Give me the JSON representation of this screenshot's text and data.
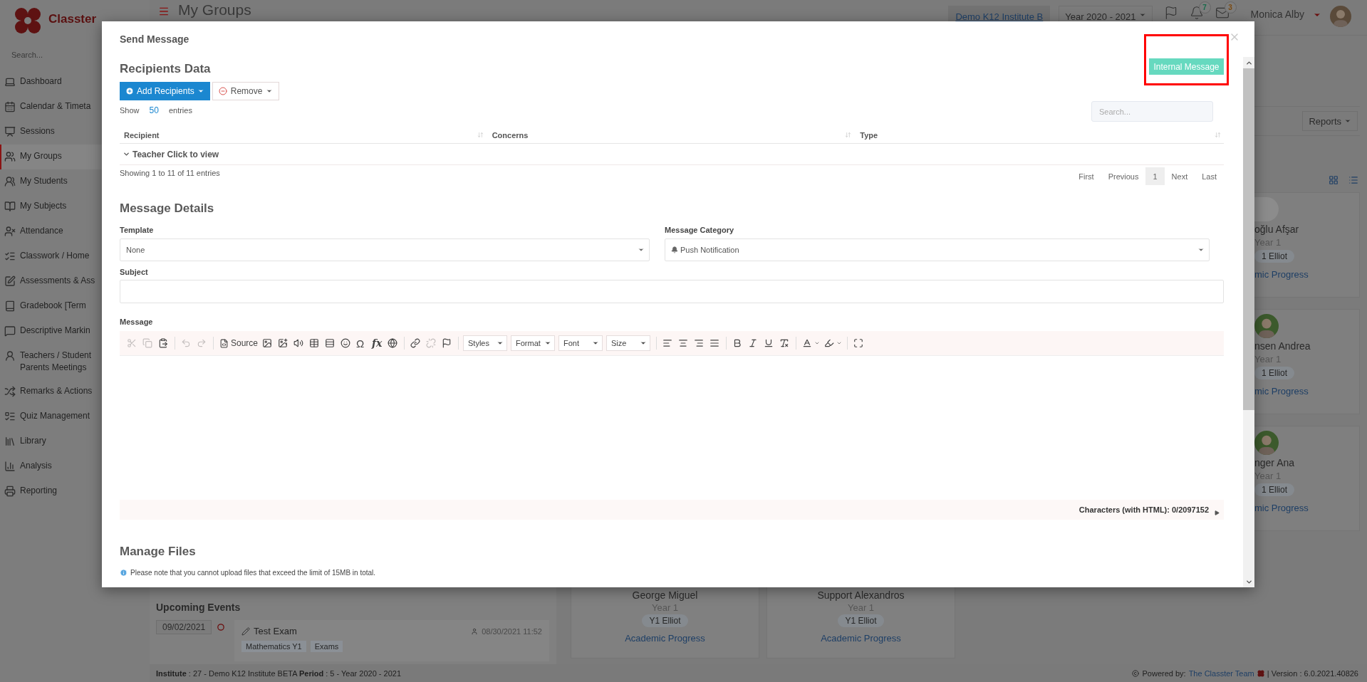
{
  "sidebar": {
    "logo": "Classter",
    "search": {
      "placeholder": "Search..."
    },
    "items": [
      {
        "label": "Dashboard",
        "selected": false
      },
      {
        "label": "Calendar & Timeta",
        "selected": false
      },
      {
        "label": "Sessions",
        "selected": false
      },
      {
        "label": "My Groups",
        "selected": true
      },
      {
        "label": "My Students",
        "selected": false
      },
      {
        "label": "My Subjects",
        "selected": false
      },
      {
        "label": "Attendance",
        "selected": false
      },
      {
        "label": "Classwork / Home",
        "selected": false
      },
      {
        "label": "Assessments & Ass",
        "selected": false
      },
      {
        "label": "Gradebook [Term",
        "selected": false
      },
      {
        "label": "Descriptive Markin",
        "selected": false
      },
      {
        "label": "Teachers / Student Parents Meetings",
        "selected": false
      },
      {
        "label": "Remarks & Actions",
        "selected": false
      },
      {
        "label": "Quiz Management",
        "selected": false
      },
      {
        "label": "Library",
        "selected": false
      },
      {
        "label": "Analysis",
        "selected": false
      },
      {
        "label": "Reporting",
        "selected": false
      }
    ]
  },
  "topbar": {
    "title": "My Groups",
    "institute": "Demo K12 Institute B",
    "year": "Year 2020 - 2021",
    "notifications": "7",
    "messages": "3",
    "user": "Monica Alby"
  },
  "reports_button": "Reports",
  "student_cards": [
    {
      "name": "oğlu Afşar",
      "year": "Year 1",
      "group": "1 Elliot",
      "link": "mic Progress",
      "photo": false
    },
    {
      "name": "nsen Andrea",
      "year": "Year 1",
      "group": "1 Elliot",
      "link": "mic Progress",
      "photo": true
    },
    {
      "name": "nger Ana",
      "year": "Year 1",
      "group": "1 Elliot",
      "link": "mic Progress",
      "photo": true
    }
  ],
  "upcoming_events": {
    "title": "Upcoming Events",
    "date": "09/02/2021",
    "event": {
      "title": "Test Exam",
      "timestamp": "08/30/2021 11:52",
      "tags": [
        "Mathematics Y1",
        "Exams"
      ]
    }
  },
  "group_cards": [
    {
      "name": "George Miguel",
      "year": "Year 1",
      "group": "Y1 Elliot",
      "link": "Academic Progress"
    },
    {
      "name": "Support Alexandros",
      "year": "Year 1",
      "group": "Y1 Elliot",
      "link": "Academic Progress"
    }
  ],
  "footer": {
    "info": "**Institute** : 27 - Demo K12 Institute BETA **Period** : 5 - Year 2020 - 2021",
    "powered_by": "Powered by:",
    "team_link": "The Classter Team",
    "version": "| Version : 6.0.2021.40826"
  },
  "modal": {
    "title": "Send Message",
    "message_type": "Internal Message",
    "recipients": {
      "heading": "Recipients Data",
      "add_button": "Add Recipients",
      "remove_button": "Remove",
      "show_label": "Show",
      "page_size": "50",
      "entries_label": "entries",
      "search": {
        "placeholder": "Search..."
      },
      "columns": [
        "Recipient",
        "Concerns",
        "Type"
      ],
      "groups": [
        "Teacher Click to view"
      ],
      "info": "Showing 1 to 11 of 11 entries",
      "pagination": [
        {
          "label": "First",
          "selected": false
        },
        {
          "label": "Previous",
          "selected": false
        },
        {
          "label": "1",
          "selected": true
        },
        {
          "label": "Next",
          "selected": false
        },
        {
          "label": "Last",
          "selected": false
        }
      ]
    },
    "details": {
      "heading": "Message Details",
      "template": {
        "label": "Template",
        "value": "None"
      },
      "category": {
        "label": "Message Category",
        "value": "Push Notification"
      },
      "subject": {
        "label": "Subject"
      },
      "message": {
        "label": "Message",
        "toolbar": [
          [
            {
              "kind": "cut",
              "disabled": true
            },
            {
              "kind": "copy",
              "disabled": true
            },
            {
              "kind": "paste",
              "disabled": false
            }
          ],
          [
            {
              "kind": "undo",
              "disabled": true
            },
            {
              "kind": "redo",
              "disabled": true
            }
          ],
          [
            {
              "kind": "source",
              "label": "Source",
              "disabled": false
            },
            {
              "kind": "image",
              "disabled": false
            },
            {
              "kind": "picture",
              "disabled": false
            },
            {
              "kind": "audio",
              "disabled": false
            },
            {
              "kind": "table",
              "disabled": false
            },
            {
              "kind": "rule",
              "disabled": false
            },
            {
              "kind": "smiley",
              "disabled": false
            },
            {
              "kind": "text",
              "label": "Ω",
              "disabled": false
            },
            {
              "kind": "formula",
              "label": "fx",
              "disabled": false
            },
            {
              "kind": "globe",
              "disabled": false
            }
          ],
          [
            {
              "kind": "link",
              "disabled": false
            },
            {
              "kind": "unlink",
              "disabled": true
            },
            {
              "kind": "anchor",
              "disabled": false
            }
          ],
          [
            {
              "kind": "dropdown",
              "label": "Styles"
            },
            {
              "kind": "dropdown",
              "label": "Format"
            },
            {
              "kind": "dropdown",
              "label": "Font"
            },
            {
              "kind": "dropdown",
              "label": "Size"
            }
          ],
          [
            {
              "kind": "align-left",
              "disabled": false
            },
            {
              "kind": "align-center",
              "disabled": false
            },
            {
              "kind": "align-right",
              "disabled": false
            },
            {
              "kind": "justify",
              "disabled": false
            }
          ],
          [
            {
              "kind": "bold",
              "disabled": false
            },
            {
              "kind": "italic",
              "disabled": false
            },
            {
              "kind": "underline",
              "disabled": false
            },
            {
              "kind": "clear-format",
              "disabled": false
            }
          ],
          [
            {
              "kind": "text-color",
              "disabled": false
            },
            {
              "kind": "bg-color",
              "disabled": false
            }
          ],
          [
            {
              "kind": "maximize",
              "disabled": false
            }
          ]
        ],
        "counter": "Characters (with HTML): 0/2097152"
      }
    },
    "files": {
      "heading": "Manage Files",
      "note": "Please note that you cannot upload files that exceed the limit of 15MB in total."
    }
  }
}
